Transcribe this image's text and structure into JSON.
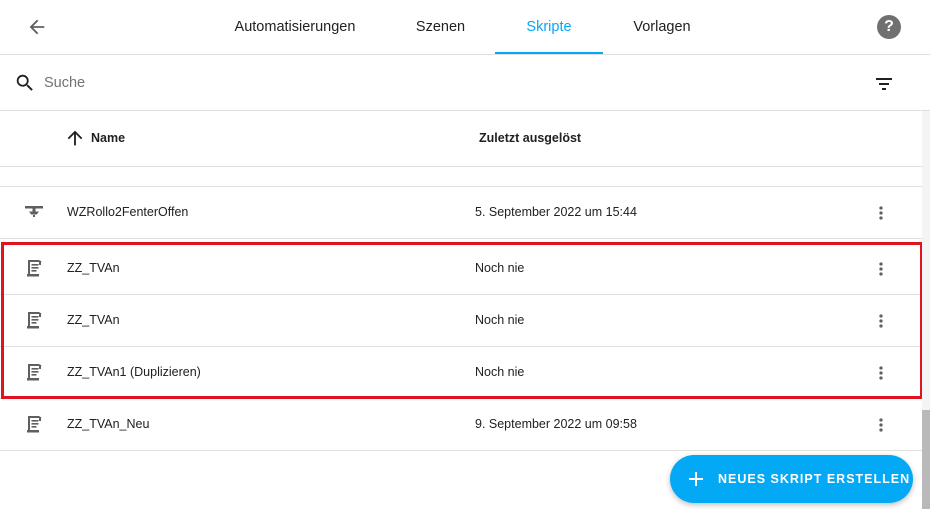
{
  "header": {
    "back_icon": "arrow-left-icon",
    "help_icon": "help-circle-icon",
    "help_label": "?",
    "tabs": [
      {
        "label": "Automatisierungen",
        "active": false
      },
      {
        "label": "Szenen",
        "active": false
      },
      {
        "label": "Skripte",
        "active": true
      },
      {
        "label": "Vorlagen",
        "active": false
      }
    ]
  },
  "search": {
    "placeholder": "Suche",
    "value": "",
    "search_icon": "magnify-icon",
    "filter_icon": "filter-icon"
  },
  "table": {
    "sort_icon": "arrow-up-icon",
    "columns": {
      "name": "Name",
      "last_triggered": "Zuletzt ausgelöst"
    },
    "rows": [
      {
        "icon": "ceiling-lamp-icon",
        "name": "WZRollo2FenterOffen",
        "last_triggered": "5. September 2022 um 15:44"
      },
      {
        "icon": "script-text-icon",
        "name": "ZZ_TVAn",
        "last_triggered": "Noch nie"
      },
      {
        "icon": "script-text-icon",
        "name": "ZZ_TVAn",
        "last_triggered": "Noch nie"
      },
      {
        "icon": "script-text-icon",
        "name": "ZZ_TVAn1 (Duplizieren)",
        "last_triggered": "Noch nie"
      },
      {
        "icon": "script-text-icon",
        "name": "ZZ_TVAn_Neu",
        "last_triggered": "9. September 2022 um 09:58"
      }
    ]
  },
  "fab": {
    "icon": "plus-icon",
    "label": "NEUES SKRIPT ERSTELLEN"
  },
  "colors": {
    "accent": "#03a9f4",
    "highlight": "#e0141e",
    "text": "#212121",
    "divider": "#e0e0e0"
  }
}
